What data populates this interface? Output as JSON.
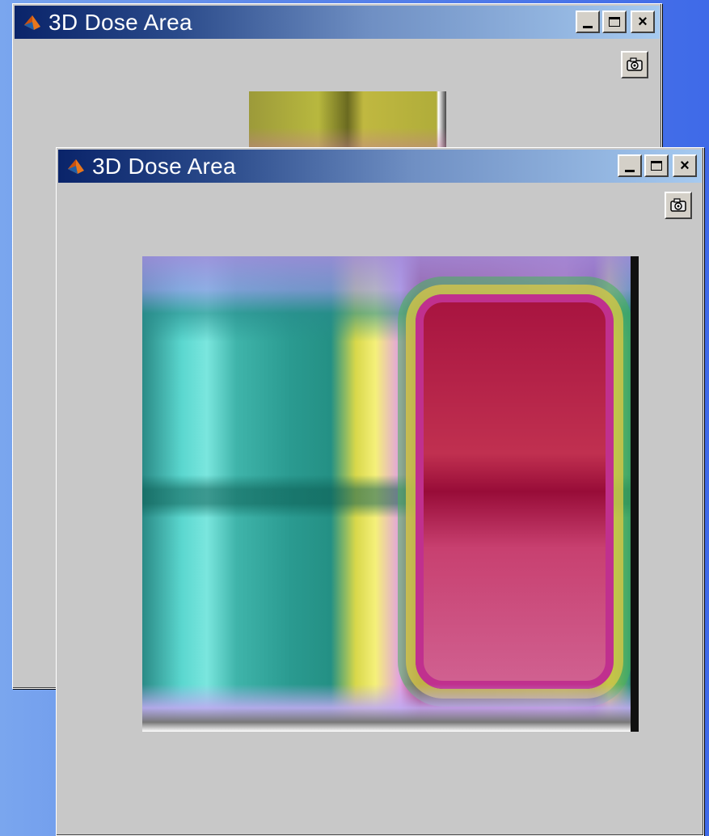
{
  "windows": [
    {
      "title": "3D Dose Area",
      "state": "background"
    },
    {
      "title": "3D Dose Area",
      "state": "active"
    }
  ],
  "controls": {
    "minimize_icon": "minimize-icon",
    "maximize_icon": "maximize-icon",
    "close_label": "×",
    "camera_icon": "camera-icon"
  },
  "colors": {
    "titlebar_start": "#0a246a",
    "titlebar_end": "#a6caf0",
    "window_bg": "#c8c8c8",
    "desktop": "#5b86ea"
  }
}
